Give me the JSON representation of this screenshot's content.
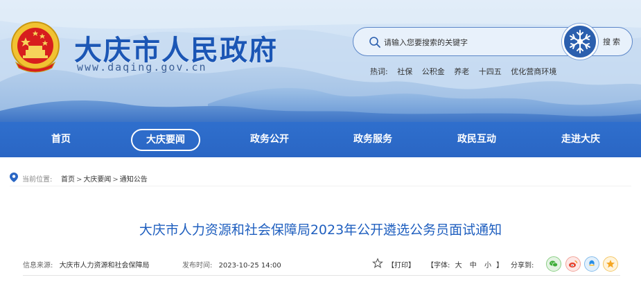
{
  "header": {
    "site_title": "大庆市人民政府",
    "site_url": "www.daqing.gov.cn",
    "emblem_icon": "national-emblem-icon"
  },
  "search": {
    "placeholder": "请输入您要搜索的关键字",
    "button_label": "搜索",
    "badge_icon": "snowflake-icon"
  },
  "hotwords": {
    "label": "热词:",
    "items": [
      "社保",
      "公积金",
      "养老",
      "十四五",
      "优化营商环境"
    ]
  },
  "nav": {
    "items": [
      "首页",
      "大庆要闻",
      "政务公开",
      "政务服务",
      "政民互动",
      "走进大庆"
    ],
    "active_index": 1
  },
  "breadcrumb": {
    "label": "当前位置:",
    "items": [
      "首页",
      "大庆要闻",
      "通知公告"
    ],
    "separator": ">"
  },
  "article": {
    "title": "大庆市人力资源和社会保障局2023年公开遴选公务员面试通知",
    "source_label": "信息来源:",
    "source_value": "大庆市人力资源和社会保障局",
    "date_label": "发布时间:",
    "date_value": "2023-10-25 14:00"
  },
  "tools": {
    "favorite_icon": "star-icon",
    "print_label": "【打印】",
    "font_label": "【字体:",
    "font_sizes": [
      "大",
      "中",
      "小"
    ],
    "font_close": "】",
    "share_label": "分享到:",
    "share_targets": [
      "wechat",
      "weibo",
      "qq",
      "qzone"
    ]
  },
  "colors": {
    "nav_bg": "#2a66c4",
    "title_blue": "#1b56b5",
    "article_title": "#1f5fbf"
  }
}
